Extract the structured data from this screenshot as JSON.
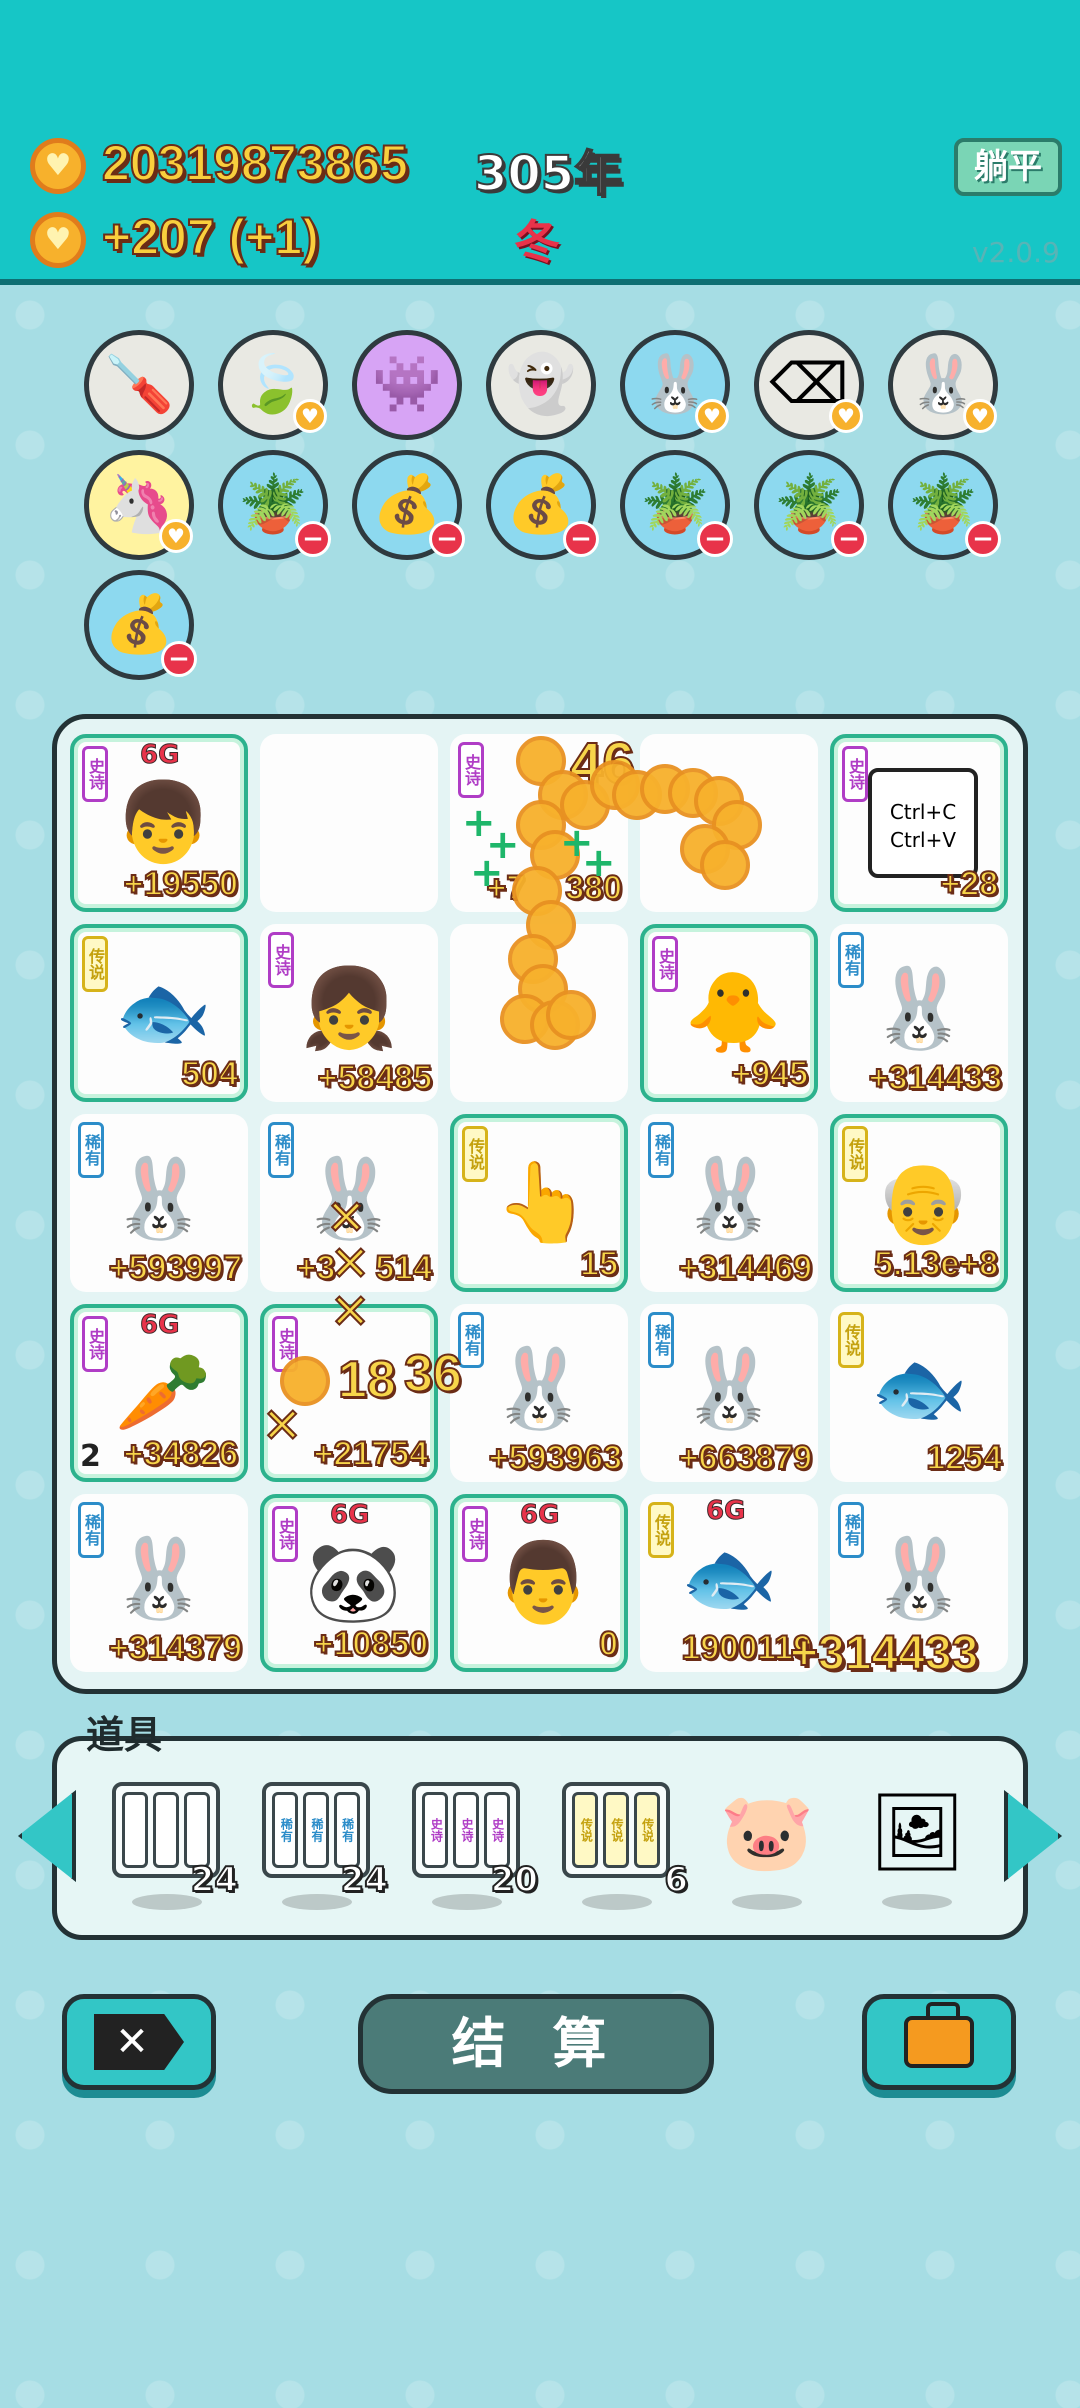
{
  "header": {
    "coins": "20319873865",
    "income": "+207",
    "income_bonus": "(+1)",
    "year": "305年",
    "season": "冬",
    "lie_flat_button": "躺平",
    "version": "v2.0.9"
  },
  "symbols": [
    {
      "icon": "screwdriver-icon",
      "glyph": "🪛",
      "bg": "grey",
      "badge": ""
    },
    {
      "icon": "leaf-icon",
      "glyph": "🍃",
      "bg": "grey",
      "badge": "heart"
    },
    {
      "icon": "ghost-robot-icon",
      "glyph": "👾",
      "bg": "purple",
      "badge": ""
    },
    {
      "icon": "ghost-icon",
      "glyph": "👻",
      "bg": "grey",
      "badge": ""
    },
    {
      "icon": "bunny-icon",
      "glyph": "🐰",
      "bg": "blue",
      "badge": "heart"
    },
    {
      "icon": "remove-tag-icon",
      "glyph": "⌫",
      "bg": "grey",
      "badge": "heart"
    },
    {
      "icon": "bunny-icon",
      "glyph": "🐰",
      "bg": "grey",
      "badge": "heart"
    },
    {
      "icon": "unicorn-icon",
      "glyph": "🦄",
      "bg": "yellow",
      "badge": "heart"
    },
    {
      "icon": "flower-pot-icon",
      "glyph": "🪴",
      "bg": "blue",
      "badge": "minus"
    },
    {
      "icon": "money-bag-icon",
      "glyph": "💰",
      "bg": "blue",
      "badge": "minus"
    },
    {
      "icon": "money-bag-icon",
      "glyph": "💰",
      "bg": "blue",
      "badge": "minus"
    },
    {
      "icon": "flower-pot-icon",
      "glyph": "🪴",
      "bg": "blue",
      "badge": "minus"
    },
    {
      "icon": "flower-pot-icon",
      "glyph": "🪴",
      "bg": "blue",
      "badge": "minus"
    },
    {
      "icon": "flower-pot-icon",
      "glyph": "🪴",
      "bg": "blue",
      "badge": "minus"
    },
    {
      "icon": "money-bag-icon",
      "glyph": "💰",
      "bg": "blue",
      "badge": "minus"
    }
  ],
  "board": {
    "cells": [
      {
        "tag": "史诗",
        "rarity": "epic",
        "framed": true,
        "icon": "boy-red-cap-icon",
        "glyph": "👦",
        "value": "+19550",
        "g6": "6G"
      },
      {
        "tag": "",
        "rarity": "",
        "framed": false,
        "icon": "",
        "glyph": "",
        "value": ""
      },
      {
        "tag": "史诗",
        "rarity": "epic",
        "framed": false,
        "icon": "coins-burst-icon",
        "glyph": "",
        "value": "+7",
        "value_tail": "380"
      },
      {
        "tag": "",
        "rarity": "",
        "framed": false,
        "icon": "",
        "glyph": "",
        "value": ""
      },
      {
        "tag": "史诗",
        "rarity": "epic",
        "framed": true,
        "icon": "copy-paste-icon",
        "glyph": "📋",
        "value": "+28",
        "note": "Ctrl+C Ctrl+V"
      },
      {
        "tag": "传说",
        "rarity": "legend",
        "framed": true,
        "icon": "koi-fish-icon",
        "glyph": "🐟",
        "value": "504"
      },
      {
        "tag": "史诗",
        "rarity": "epic",
        "framed": false,
        "icon": "girl-braids-icon",
        "glyph": "👧",
        "value": "+58485"
      },
      {
        "tag": "",
        "rarity": "",
        "framed": false,
        "icon": "coins-stack-icon",
        "glyph": "",
        "value": ""
      },
      {
        "tag": "史诗",
        "rarity": "epic",
        "framed": true,
        "icon": "grey-hair-chick-icon",
        "glyph": "🐥",
        "value": "+945"
      },
      {
        "tag": "稀有",
        "rarity": "rare",
        "framed": false,
        "icon": "bunny-icon",
        "glyph": "🐰",
        "value": "+314433"
      },
      {
        "tag": "稀有",
        "rarity": "rare",
        "framed": false,
        "icon": "bunny-icon",
        "glyph": "🐰",
        "value": "+593997"
      },
      {
        "tag": "稀有",
        "rarity": "rare",
        "framed": false,
        "icon": "bunny-icon",
        "glyph": "🐰",
        "value": "+3",
        "value_tail": "514"
      },
      {
        "tag": "传说",
        "rarity": "legend",
        "framed": true,
        "icon": "pointing-hand-icon",
        "glyph": "👆",
        "value": "15"
      },
      {
        "tag": "稀有",
        "rarity": "rare",
        "framed": false,
        "icon": "bunny-icon",
        "glyph": "🐰",
        "value": "+314469"
      },
      {
        "tag": "传说",
        "rarity": "legend",
        "framed": true,
        "icon": "crowned-grandpa-icon",
        "glyph": "👴",
        "value": "5.13e+8"
      },
      {
        "tag": "史诗",
        "rarity": "epic",
        "framed": true,
        "icon": "crowned-carrot-icon",
        "glyph": "🥕",
        "value": "+34826",
        "g6": "6G",
        "left": "2"
      },
      {
        "tag": "史诗",
        "rarity": "epic",
        "framed": true,
        "icon": "hidden-symbol-icon",
        "glyph": "",
        "value": "+21754"
      },
      {
        "tag": "稀有",
        "rarity": "rare",
        "framed": false,
        "icon": "bunny-icon",
        "glyph": "🐰",
        "value": "+593963"
      },
      {
        "tag": "稀有",
        "rarity": "rare",
        "framed": false,
        "icon": "bunny-icon",
        "glyph": "🐰",
        "value": "+663879"
      },
      {
        "tag": "传说",
        "rarity": "legend",
        "framed": false,
        "icon": "koi-fish-icon",
        "glyph": "🐟",
        "value": "1254"
      },
      {
        "tag": "稀有",
        "rarity": "rare",
        "framed": false,
        "icon": "bunny-icon",
        "glyph": "🐰",
        "value": "+314379"
      },
      {
        "tag": "史诗",
        "rarity": "epic",
        "framed": true,
        "icon": "crowned-panda-icon",
        "glyph": "🐼",
        "value": "+10850",
        "g6": "6G"
      },
      {
        "tag": "史诗",
        "rarity": "epic",
        "framed": true,
        "icon": "crowned-old-man-icon",
        "glyph": "👨",
        "value": "0",
        "g6": "6G"
      },
      {
        "tag": "传说",
        "rarity": "legend",
        "framed": false,
        "icon": "crowned-koi-icon",
        "glyph": "🐟",
        "value": "1900119",
        "g6": "6G"
      },
      {
        "tag": "稀有",
        "rarity": "rare",
        "framed": false,
        "icon": "bunny-icon",
        "glyph": "🐰",
        "value": ""
      }
    ],
    "big_value": "+314433",
    "fx_numbers": [
      "46",
      "18",
      "36"
    ]
  },
  "items": {
    "label": "道具",
    "list": [
      {
        "icon": "empty-slots-icon",
        "slots": [
          "",
          "",
          ""
        ],
        "count": "24",
        "tone": "plain"
      },
      {
        "icon": "rare-slots-icon",
        "slots": [
          "稀有",
          "稀有",
          "稀有"
        ],
        "count": "24",
        "tone": "rare"
      },
      {
        "icon": "epic-slots-icon",
        "slots": [
          "史诗",
          "史诗",
          "史诗"
        ],
        "count": "20",
        "tone": "epic"
      },
      {
        "icon": "legend-slots-icon",
        "slots": [
          "传说",
          "传说",
          "传说"
        ],
        "count": "6",
        "tone": "legend"
      },
      {
        "icon": "piggy-bank-icon",
        "glyph": "🐷",
        "count": ""
      },
      {
        "icon": "frame-icon",
        "glyph": "🖼",
        "count": ""
      }
    ]
  },
  "actions": {
    "settle_button": "结 算",
    "remove_icon": "✕"
  },
  "colors": {
    "topbar": "#16c6c6",
    "background": "#a6dde4",
    "gold": "#f9cf3d",
    "epic": "#b03dc6",
    "rare": "#2c8dc9",
    "legend": "#d6b31a"
  }
}
